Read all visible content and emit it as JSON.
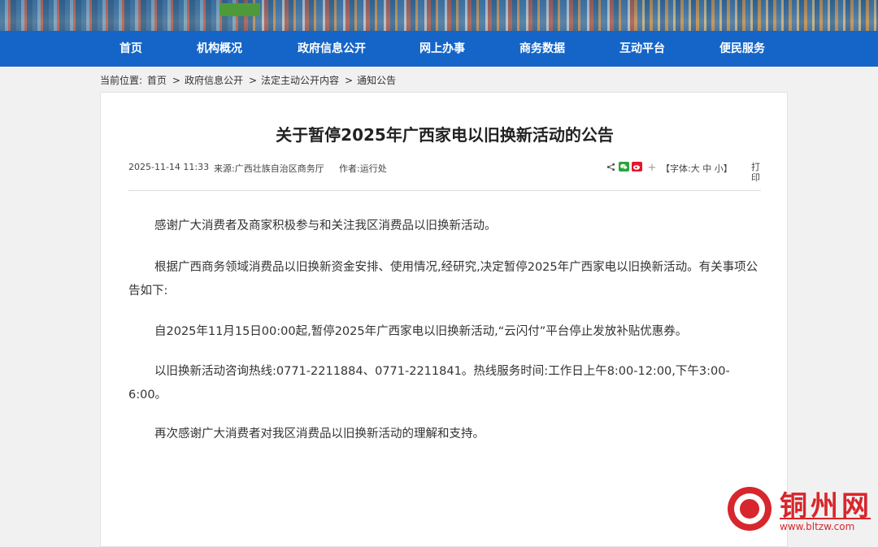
{
  "nav": {
    "items": [
      "首页",
      "机构概况",
      "政府信息公开",
      "网上办事",
      "商务数据",
      "互动平台",
      "便民服务"
    ]
  },
  "breadcrumb": {
    "prefix": "当前位置:",
    "items": [
      "首页",
      "政府信息公开",
      "法定主动公开内容",
      "通知公告"
    ],
    "separator": ">"
  },
  "article": {
    "title": "关于暂停2025年广西家电以旧换新活动的公告",
    "date": "2025-11-14 11:33",
    "source": "来源:广西壮族自治区商务厅",
    "author": "作者:运行处",
    "font_size_label": "【字体:大 中 小】",
    "print_label": "打印",
    "paragraphs": [
      "感谢广大消费者及商家积极参与和关注我区消费品以旧换新活动。",
      "根据广西商务领域消费品以旧换新资金安排、使用情况,经研究,决定暂停2025年广西家电以旧换新活动。有关事项公告如下:",
      "自2025年11月15日00:00起,暂停2025年广西家电以旧换新活动,“云闪付”平台停止发放补贴优惠券。",
      "以旧换新活动咨询热线:0771-2211884、0771-2211841。热线服务时间:工作日上午8:00-12:00,下午3:00-6:00。",
      "再次感谢广大消费者对我区消费品以旧换新活动的理解和支持。"
    ]
  },
  "share_icons": [
    "share-icon",
    "wechat-icon",
    "weibo-icon",
    "plus-icon"
  ],
  "watermark": {
    "name": "铜州网",
    "url": "www.bltzw.com"
  },
  "colors": {
    "nav_bg": "#1565c8",
    "watermark_red": "#d7262c"
  }
}
